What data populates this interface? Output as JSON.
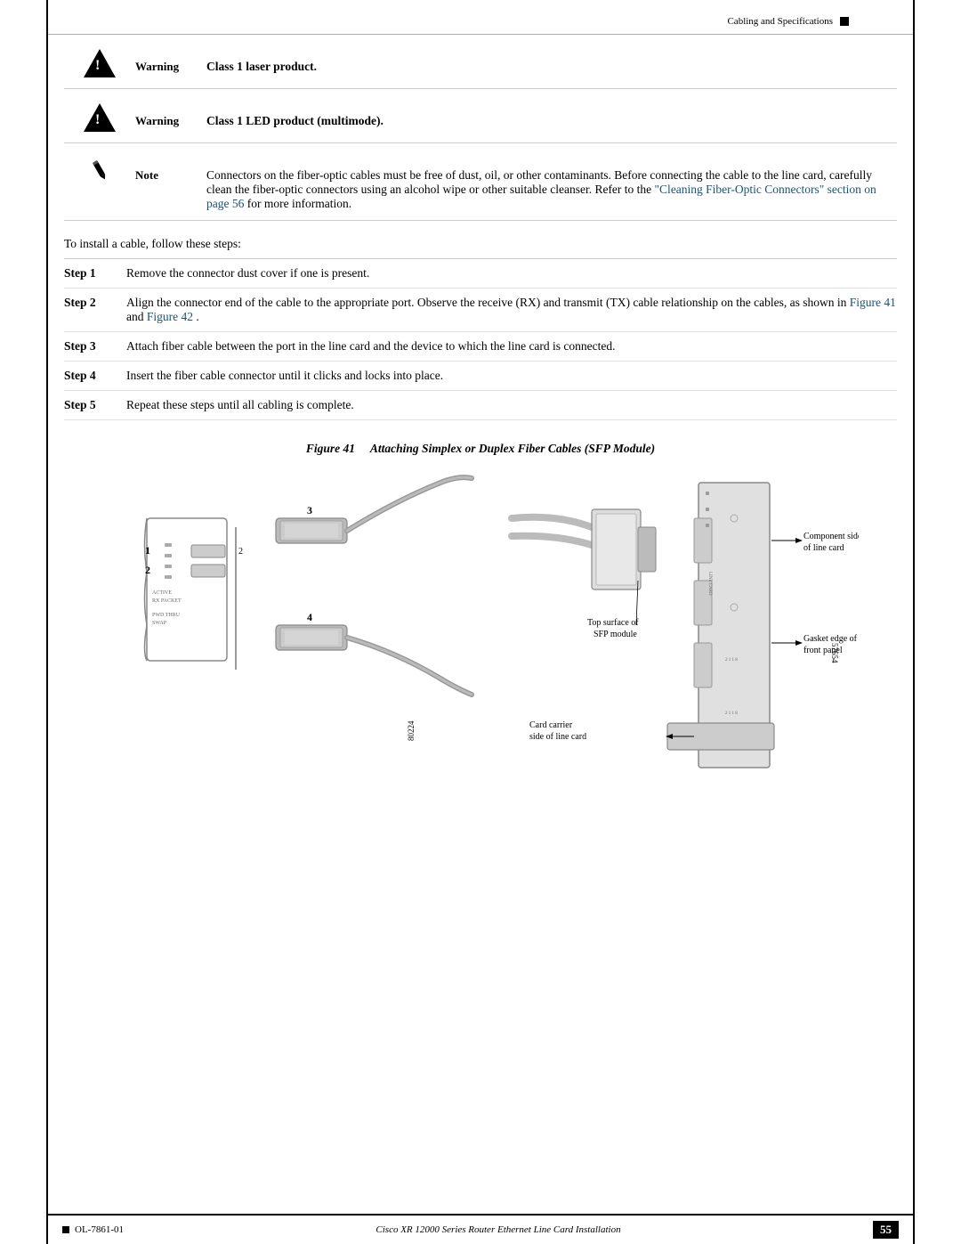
{
  "header": {
    "title": "Cabling and Specifications",
    "square": "■"
  },
  "warnings": [
    {
      "id": "warning1",
      "label": "Warning",
      "text": "Class 1 laser product."
    },
    {
      "id": "warning2",
      "label": "Warning",
      "text": "Class 1 LED product (multimode)."
    }
  ],
  "note": {
    "label": "Note",
    "text": "Connectors on the fiber-optic cables must be free of dust, oil, or other contaminants. Before connecting the cable to the line card, carefully clean the fiber-optic connectors using an alcohol wipe or other suitable cleanser. Refer to the",
    "link_text": "\"Cleaning Fiber-Optic Connectors\" section on page 56",
    "text_after": "for more information."
  },
  "intro_text": "To install a cable, follow these steps:",
  "steps": [
    {
      "number": "Step 1",
      "text": "Remove the connector dust cover if one is present."
    },
    {
      "number": "Step 2",
      "text": "Align the connector end of the cable to the appropriate port. Observe the receive (RX) and transmit (TX) cable relationship on the cables, as shown in",
      "link1": "Figure 41",
      "between": "and",
      "link2": "Figure 42",
      "text_after": "."
    },
    {
      "number": "Step 3",
      "text": "Attach fiber cable between the port in the line card and the device to which the line card is connected."
    },
    {
      "number": "Step 4",
      "text": "Insert the fiber cable connector until it clicks and locks into place."
    },
    {
      "number": "Step 5",
      "text": "Repeat these steps until all cabling is complete."
    }
  ],
  "figure": {
    "number": "41",
    "title": "Attaching Simplex or Duplex Fiber Cables (SFP Module)"
  },
  "diagram_labels": {
    "left_numbers": [
      "1",
      "2",
      "3",
      "4"
    ],
    "left_code": "80224",
    "right_code": "57654",
    "component_side": "Component side\nof line card",
    "gasket_edge": "Gasket edge of\nfront panel",
    "top_surface": "Top surface of\nSFP module",
    "card_carrier": "Card carrier\nside of line card"
  },
  "footer": {
    "left_label": "OL-7861-01",
    "center_text": "Cisco XR 12000 Series Router Ethernet Line Card Installation",
    "page_number": "55"
  }
}
